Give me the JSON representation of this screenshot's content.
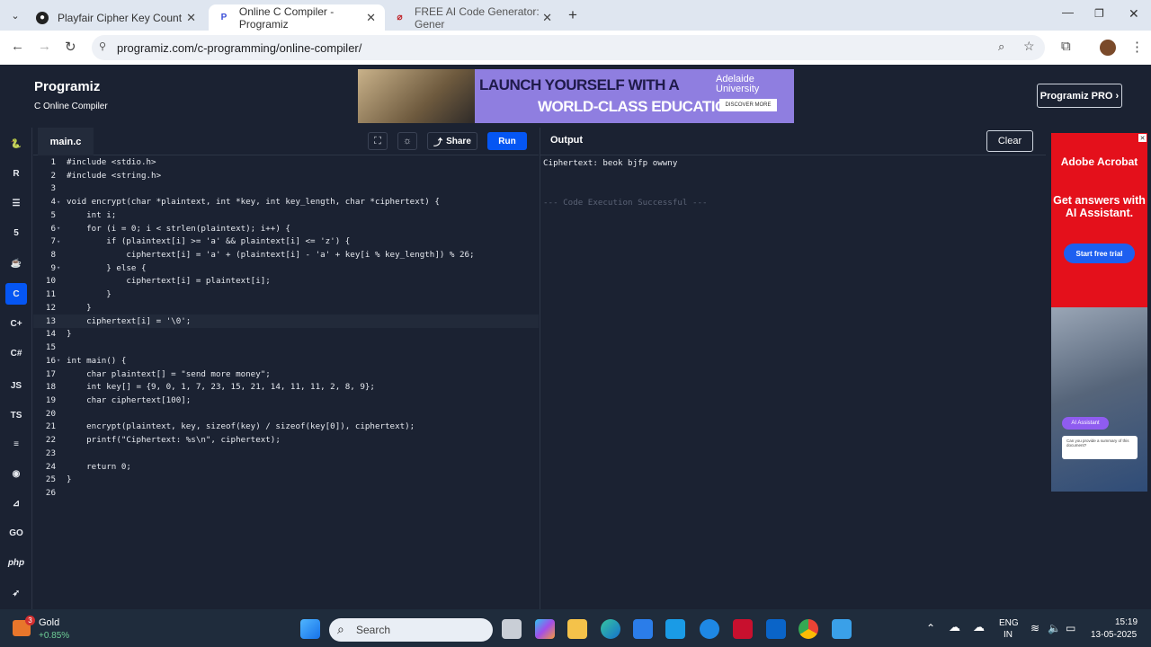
{
  "browser": {
    "tabs": [
      {
        "title": "Playfair Cipher Key Count",
        "active": false
      },
      {
        "title": "Online C Compiler - Programiz",
        "active": true
      },
      {
        "title": "FREE AI Code Generator: Gener",
        "active": false
      }
    ],
    "url": "programiz.com/c-programming/online-compiler/"
  },
  "site": {
    "logo": "Programiz",
    "subtitle": "C Online Compiler",
    "banner_line1": "LAUNCH YOURSELF WITH A",
    "banner_line2": "WORLD-CLASS EDUCATION",
    "banner_uni": "Adelaide University",
    "banner_cta": "DISCOVER MORE",
    "pro_button": "Programiz PRO ›"
  },
  "sidebar": [
    "python-icon",
    "r-icon",
    "sql-icon",
    "html-icon",
    "java-icon",
    "c-icon",
    "cpp-icon",
    "csharp-icon",
    "js-icon",
    "ts-icon",
    "go-icon",
    "php-icon",
    "swift-icon",
    "rust-icon",
    "kotlin-icon"
  ],
  "editor": {
    "file_tab": "main.c",
    "share_label": "Share",
    "run_label": "Run",
    "lines": [
      "#include <stdio.h>",
      "#include <string.h>",
      "",
      "void encrypt(char *plaintext, int *key, int key_length, char *ciphertext) {",
      "    int i;",
      "    for (i = 0; i < strlen(plaintext); i++) {",
      "        if (plaintext[i] >= 'a' && plaintext[i] <= 'z') {",
      "            ciphertext[i] = 'a' + (plaintext[i] - 'a' + key[i % key_length]) % 26;",
      "        } else {",
      "            ciphertext[i] = plaintext[i];",
      "        }",
      "    }",
      "    ciphertext[i] = '\\0';",
      "}",
      "",
      "int main() {",
      "    char plaintext[] = \"send more money\";",
      "    int key[] = {9, 0, 1, 7, 23, 15, 21, 14, 11, 11, 2, 8, 9};",
      "    char ciphertext[100];",
      "",
      "    encrypt(plaintext, key, sizeof(key) / sizeof(key[0]), ciphertext);",
      "    printf(\"Ciphertext: %s\\n\", ciphertext);",
      "",
      "    return 0;",
      "}",
      ""
    ],
    "current_line": 13
  },
  "output": {
    "title": "Output",
    "clear_label": "Clear",
    "result_line": "Ciphertext: beok bjfp owwny",
    "status_line": "--- Code Execution Successful ---"
  },
  "ad": {
    "brand": "Adobe Acrobat",
    "headline": "Get answers with AI Assistant.",
    "cta": "Start free trial",
    "pill": "AI Assistant",
    "question": "Can you provide a summary of this document?"
  },
  "taskbar": {
    "weather_title": "Gold",
    "weather_value": "+0.85%",
    "weather_badge": "3",
    "search_placeholder": "Search",
    "lang1": "ENG",
    "lang2": "IN",
    "time": "15:19",
    "date": "13-05-2025"
  }
}
